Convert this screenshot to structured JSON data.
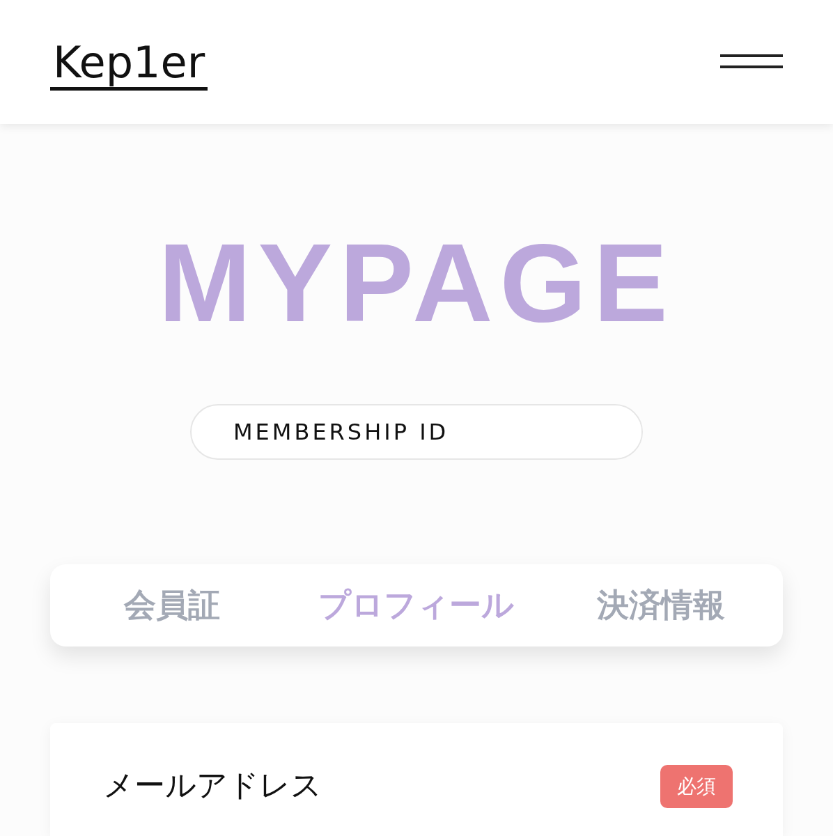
{
  "header": {
    "logo": "Kep1er"
  },
  "title": "MYPAGE",
  "membership": {
    "label": "MEMBERSHIP ID"
  },
  "tabs": [
    {
      "label": "会員証",
      "selected": false
    },
    {
      "label": "プロフィール",
      "selected": true
    },
    {
      "label": "決済情報",
      "selected": false
    }
  ],
  "fields": [
    {
      "label": "メールアドレス",
      "badge": "必須"
    }
  ]
}
